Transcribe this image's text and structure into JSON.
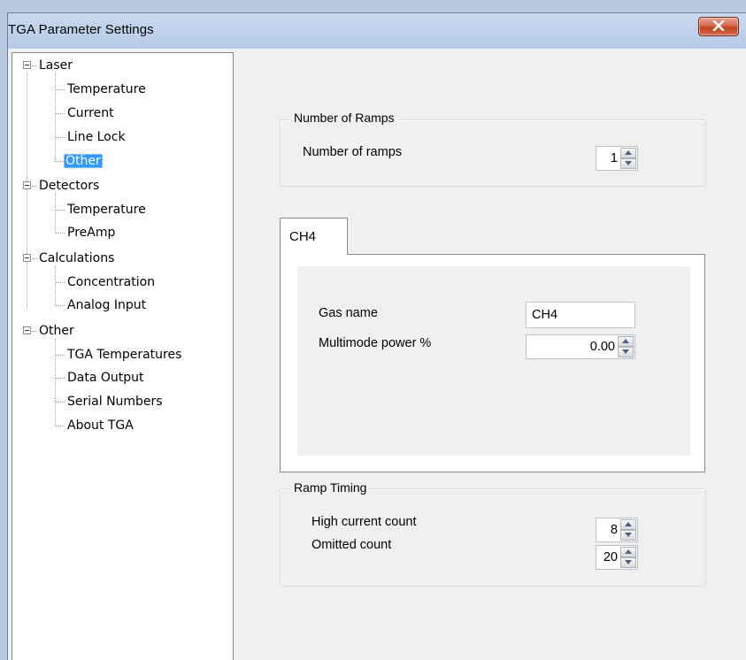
{
  "window": {
    "title": "TGA Parameter Settings"
  },
  "tree": {
    "nodes": [
      {
        "label": "Laser",
        "children": [
          "Temperature",
          "Current",
          "Line Lock",
          "Other"
        ]
      },
      {
        "label": "Detectors",
        "children": [
          "Temperature",
          "PreAmp"
        ]
      },
      {
        "label": "Calculations",
        "children": [
          "Concentration",
          "Analog Input"
        ]
      },
      {
        "label": "Other",
        "children": [
          "TGA Temperatures",
          "Data Output",
          "Serial Numbers",
          "About TGA"
        ]
      }
    ],
    "selected": "Laser/Other"
  },
  "number_of_ramps": {
    "group_title": "Number of Ramps",
    "label": "Number of ramps",
    "value": "1"
  },
  "gas_tab": {
    "tab_label": "CH4",
    "gas_name_label": "Gas name",
    "gas_name_value": "CH4",
    "multimode_label": "Multimode power %",
    "multimode_value": "0.00"
  },
  "ramp_timing": {
    "group_title": "Ramp Timing",
    "high_current_label": "High current count",
    "high_current_value": "8",
    "omitted_label": "Omitted count",
    "omitted_value": "20"
  },
  "icons": {
    "close": "close-icon",
    "expander": "collapse-icon",
    "spin_up": "spin-up-icon",
    "spin_down": "spin-down-icon"
  },
  "colors": {
    "selection": "#3399ff",
    "close_button": "#c9452a"
  }
}
